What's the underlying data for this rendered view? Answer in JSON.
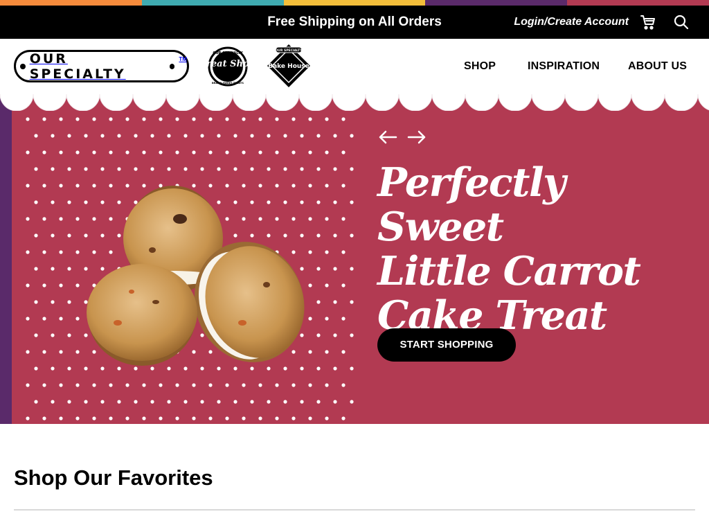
{
  "colors": {
    "rainbow": [
      "#f58b3c",
      "#3faab0",
      "#f3be3a",
      "#5a2a6a",
      "#b23a52"
    ],
    "hero_bg": "#b23a52",
    "promo_bg": "#000000"
  },
  "promo": {
    "text": "Free Shipping on All Orders",
    "login": "Login/Create Account",
    "cart_icon": "cart-icon",
    "search_icon": "search-icon"
  },
  "header": {
    "logo": "OUR SPECIALTY",
    "logo_tm": "TM",
    "brands": [
      {
        "name": "Treat Shop",
        "top_text": "OUR SPECIALTY",
        "bottom_text": "BRAND SWEET TREATS"
      },
      {
        "name": "Bake House",
        "top_text": "OUR SPECIALTY"
      }
    ],
    "nav": [
      "SHOP",
      "INSPIRATION",
      "ABOUT US"
    ]
  },
  "hero": {
    "headline": [
      "Perfectly Sweet",
      "Little Carrot",
      "Cake Treat"
    ],
    "cta": "START SHOPPING",
    "prev_icon": "arrow-left-icon",
    "next_icon": "arrow-right-icon"
  },
  "section": {
    "title": "Shop Our Favorites"
  }
}
